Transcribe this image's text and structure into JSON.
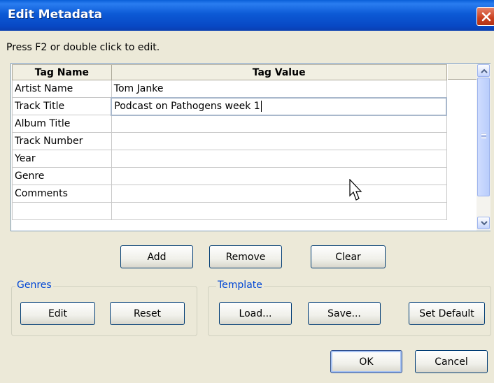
{
  "window": {
    "title": "Edit Metadata"
  },
  "instruction": "Press F2 or double click to edit.",
  "grid": {
    "columns": [
      "Tag Name",
      "Tag Value"
    ],
    "rows": [
      {
        "name": "Artist Name",
        "value": "Tom Janke"
      },
      {
        "name": "Track Title",
        "value": "Podcast on Pathogens week 1"
      },
      {
        "name": "Album Title",
        "value": ""
      },
      {
        "name": "Track Number",
        "value": ""
      },
      {
        "name": "Year",
        "value": ""
      },
      {
        "name": "Genre",
        "value": ""
      },
      {
        "name": "Comments",
        "value": ""
      },
      {
        "name": "",
        "value": ""
      }
    ]
  },
  "row_buttons": {
    "add": "Add",
    "remove": "Remove",
    "clear": "Clear"
  },
  "genres": {
    "label": "Genres",
    "edit": "Edit",
    "reset": "Reset"
  },
  "template": {
    "label": "Template",
    "load": "Load...",
    "save": "Save...",
    "set_default": "Set Default"
  },
  "dialog_buttons": {
    "ok": "OK",
    "cancel": "Cancel"
  },
  "icons": {
    "close": "close-icon",
    "scroll_up": "chevron-up-icon",
    "scroll_down": "chevron-down-icon",
    "cursor": "mouse-pointer-icon"
  },
  "colors": {
    "titlebar": "#0a56d0",
    "close": "#c9401e",
    "face": "#ece9d8",
    "group_label": "#0046d5"
  }
}
